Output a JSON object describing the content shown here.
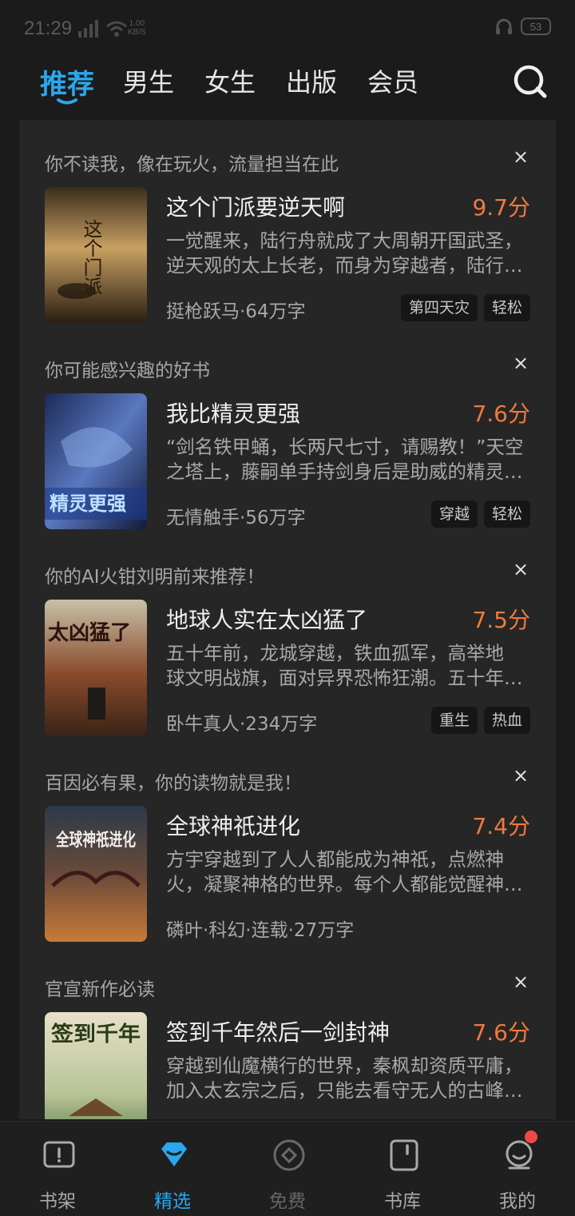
{
  "status_bar": {
    "time": "21:29",
    "speed_value": "1.00",
    "speed_unit": "KB/S",
    "battery": "53"
  },
  "tabs": [
    {
      "label": "推荐",
      "active": true
    },
    {
      "label": "男生"
    },
    {
      "label": "女生"
    },
    {
      "label": "出版"
    },
    {
      "label": "会员"
    }
  ],
  "colors": {
    "accent": "#2aa8ee",
    "score": "#f07a3c",
    "panel": "#262626",
    "background": "#1b1b1b",
    "badge": "#ee4a45"
  },
  "cards": [
    {
      "reason": "你不读我，像在玩火，流量担当在此",
      "title": "这个门派要逆天啊",
      "score": "9.7分",
      "desc_line1": "一觉醒来，陆行舟就成了大周朝开国武圣，",
      "desc_line2": "逆天观的太上长老，而身为穿越者，陆行…",
      "meta": "挺枪跃马·64万字",
      "tags": [
        "第四天灾",
        "轻松"
      ],
      "cover_text": "这个门派"
    },
    {
      "reason": "你可能感兴趣的好书",
      "title": "我比精灵更强",
      "score": "7.6分",
      "desc_line1": "“剑名铁甲蛹，长两尺七寸，请赐教！”天空",
      "desc_line2": "之塔上，藤嗣单手持剑身后是助威的精灵…",
      "meta": "无情触手·56万字",
      "tags": [
        "穿越",
        "轻松"
      ],
      "cover_text": "精灵更强"
    },
    {
      "reason": "你的AI火钳刘明前来推荐！",
      "title": "地球人实在太凶猛了",
      "score": "7.5分",
      "desc_line1": "五十年前，龙城穿越，铁血孤军，高举地",
      "desc_line2": "球文明战旗，面对异界恐怖狂潮。五十年…",
      "meta": "卧牛真人·234万字",
      "tags": [
        "重生",
        "热血"
      ],
      "cover_text": "太凶猛了"
    },
    {
      "reason": "百因必有果，你的读物就是我！",
      "title": "全球神祇进化",
      "score": "7.4分",
      "desc_line1": "方宇穿越到了人人都能成为神祇，点燃神",
      "desc_line2": "火，凝聚神格的世界。每个人都能觉醒神…",
      "meta": "磷叶·科幻·连载·27万字",
      "tags": [],
      "cover_text": "全球神祇进化"
    },
    {
      "reason": "官宣新作必读",
      "title": "签到千年然后一剑封神",
      "score": "7.6分",
      "desc_line1": "穿越到仙魔横行的世界，秦枫却资质平庸，",
      "desc_line2": "加入太玄宗之后，只能去看守无人的古峰…",
      "meta": "",
      "tags": [],
      "cover_text": "签到千年"
    }
  ],
  "close_symbol": "×",
  "bottom_nav": [
    {
      "label": "书架",
      "icon": "bookshelf-icon"
    },
    {
      "label": "精选",
      "icon": "featured-diamond-icon",
      "active": true
    },
    {
      "label": "免费",
      "icon": "free-coin-icon"
    },
    {
      "label": "书库",
      "icon": "library-book-icon"
    },
    {
      "label": "我的",
      "icon": "profile-icon"
    }
  ]
}
